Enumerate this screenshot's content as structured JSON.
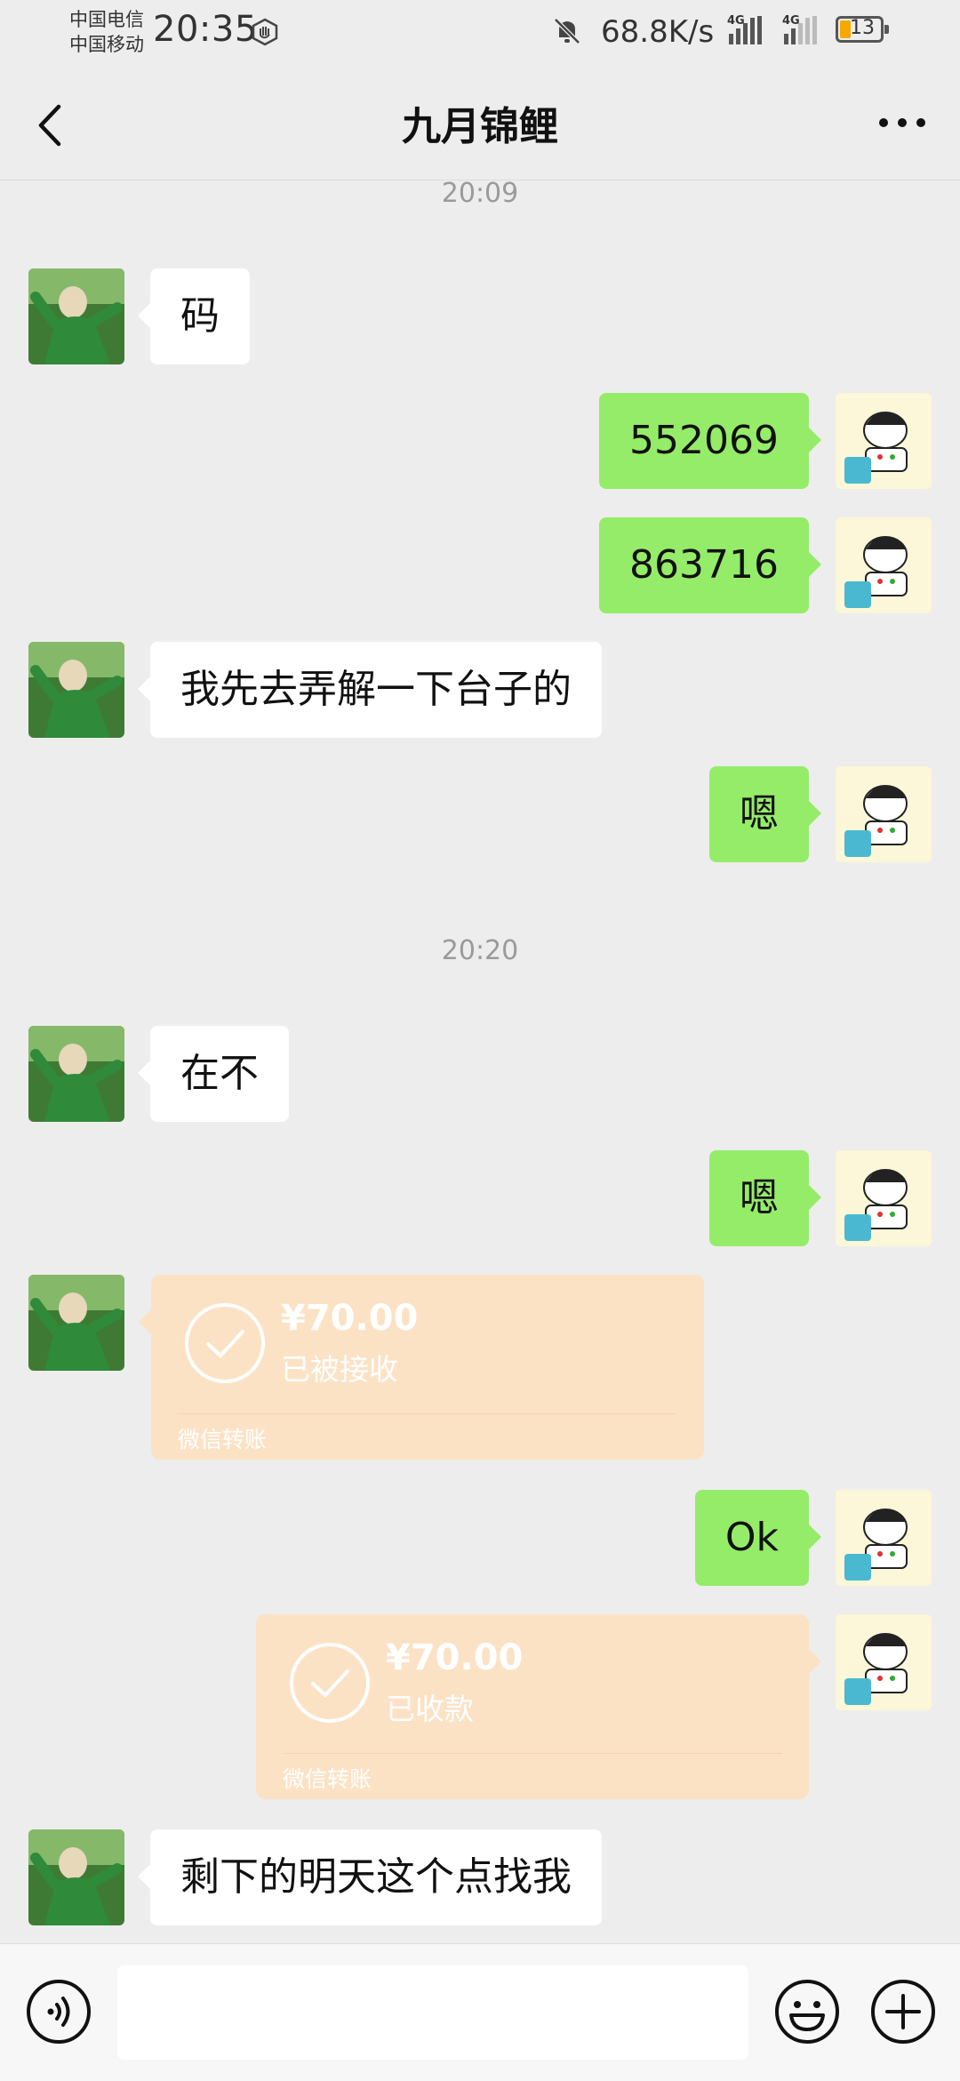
{
  "status_bar": {
    "carrier1": "中国电信",
    "carrier2": "中国移动",
    "time": "20:35",
    "net_speed": "68.8K/s",
    "network1": "4G",
    "network2": "4G",
    "battery": "13"
  },
  "header": {
    "title": "九月锦鲤",
    "back_icon": "chevron-left-icon",
    "more_icon": "more-dots-icon"
  },
  "messages": [
    {
      "type": "time",
      "text": "20:09"
    },
    {
      "type": "text",
      "side": "left",
      "text": "码"
    },
    {
      "type": "text",
      "side": "right",
      "text": "552069"
    },
    {
      "type": "text",
      "side": "right",
      "text": "863716"
    },
    {
      "type": "text",
      "side": "left",
      "text": "我先去弄解一下台子的"
    },
    {
      "type": "text",
      "side": "right",
      "text": "嗯"
    },
    {
      "type": "time",
      "text": "20:20"
    },
    {
      "type": "text",
      "side": "left",
      "text": "在不"
    },
    {
      "type": "text",
      "side": "right",
      "text": "嗯"
    },
    {
      "type": "transfer",
      "side": "left",
      "amount": "¥70.00",
      "status": "已被接收",
      "brand": "微信转账"
    },
    {
      "type": "text",
      "side": "right",
      "text": "Ok"
    },
    {
      "type": "transfer",
      "side": "right",
      "amount": "¥70.00",
      "status": "已收款",
      "brand": "微信转账"
    },
    {
      "type": "text",
      "side": "left",
      "text": "剩下的明天这个点找我"
    }
  ],
  "input_bar": {
    "voice_icon": "voice-icon",
    "emoji_icon": "emoji-icon",
    "plus_icon": "plus-circle-icon",
    "text_value": ""
  },
  "colors": {
    "background": "#ededed",
    "bubble_self": "#95ec69",
    "bubble_other": "#ffffff",
    "transfer": "#fce2c5"
  }
}
